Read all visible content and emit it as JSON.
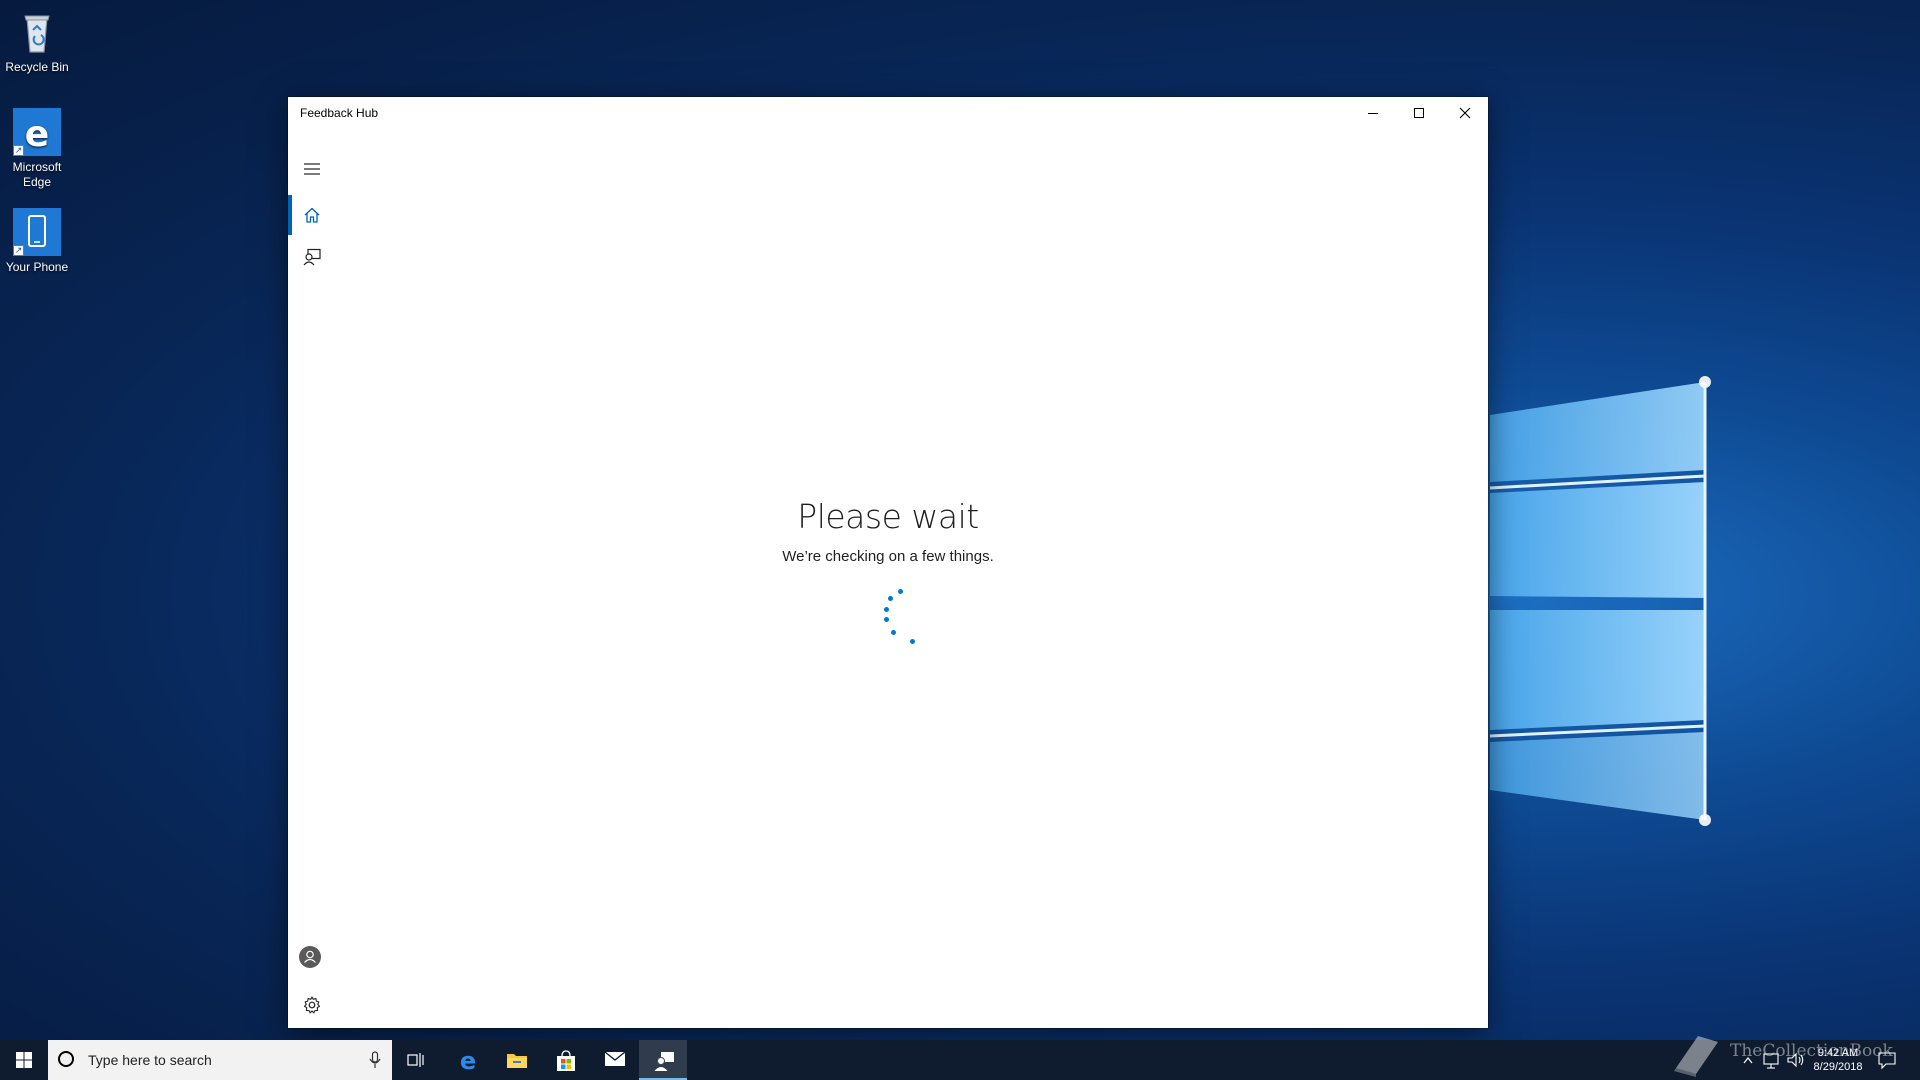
{
  "desktop": {
    "icons": [
      {
        "label": "Recycle Bin"
      },
      {
        "label": "Microsoft Edge"
      },
      {
        "label": "Your Phone"
      }
    ]
  },
  "window": {
    "title": "Feedback Hub",
    "nav": {
      "menu_icon": "hamburger-menu-icon",
      "items": [
        {
          "icon": "home-icon",
          "selected": true
        },
        {
          "icon": "feedback-icon",
          "selected": false
        }
      ],
      "bottom": [
        {
          "icon": "account-icon"
        },
        {
          "icon": "settings-icon"
        }
      ]
    },
    "content": {
      "heading": "Please wait",
      "subtext": "We’re checking on a few things."
    },
    "accent_color": "#0078d7"
  },
  "taskbar": {
    "search_placeholder": "Type here to search",
    "apps": [
      "task-view-icon",
      "edge-icon",
      "file-explorer-icon",
      "store-icon",
      "mail-icon",
      "feedback-hub-icon"
    ],
    "active_app": "feedback-hub-icon",
    "clock": {
      "time": "9:42 AM",
      "date": "8/29/2018"
    },
    "watermark": "TheCollectionBook"
  }
}
